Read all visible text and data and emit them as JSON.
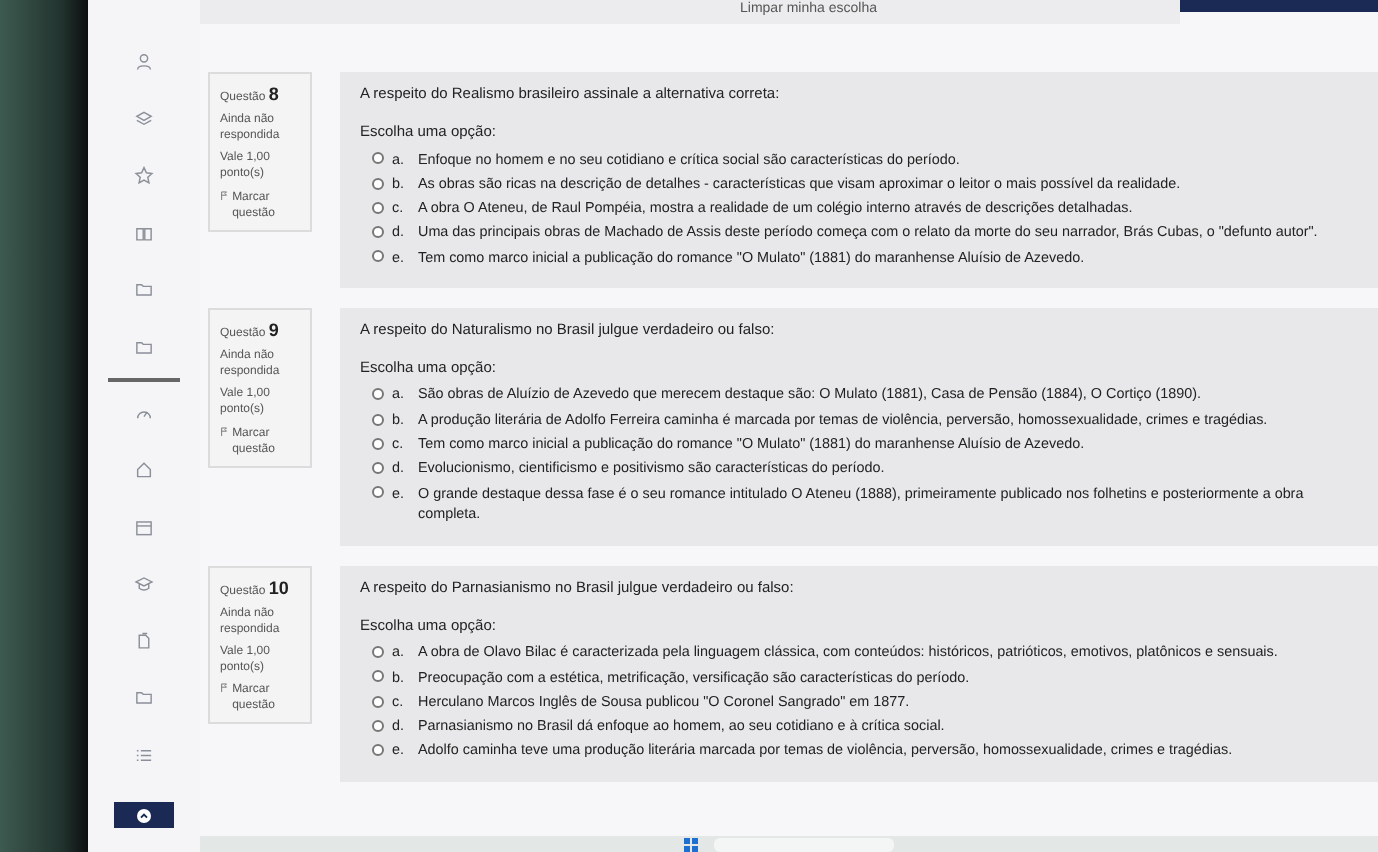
{
  "top_link": "Limpar minha escolha",
  "questions": [
    {
      "label": "Questão",
      "number": "8",
      "status": "Ainda não respondida",
      "points": "Vale 1,00 ponto(s)",
      "flag": "Marcar questão",
      "prompt": "A respeito do Realismo brasileiro assinale a alternativa correta:",
      "instruction": "Escolha uma opção:",
      "options": [
        {
          "letter": "a.",
          "text": "Enfoque no homem e no seu cotidiano e crítica social são características do período.",
          "selected": false
        },
        {
          "letter": "b.",
          "text": "As obras são ricas na descrição de detalhes - características que visam aproximar o leitor o mais possível da realidade.",
          "selected": false
        },
        {
          "letter": "c.",
          "text": "A obra O Ateneu, de Raul Pompéia, mostra a realidade de um colégio interno através de descrições detalhadas.",
          "selected": false
        },
        {
          "letter": "d.",
          "text": "Uma das principais obras de Machado de Assis deste período começa com o relato da morte do seu narrador, Brás Cubas, o \"defunto autor\".",
          "selected": false
        },
        {
          "letter": "e.",
          "text": "Tem como marco inicial a publicação do romance \"O Mulato\" (1881) do maranhense Aluísio de Azevedo.",
          "selected": false
        }
      ]
    },
    {
      "label": "Questão",
      "number": "9",
      "status": "Ainda não respondida",
      "points": "Vale 1,00 ponto(s)",
      "flag": "Marcar questão",
      "prompt": "A respeito do Naturalismo no Brasil julgue verdadeiro ou falso:",
      "instruction": "Escolha uma opção:",
      "options": [
        {
          "letter": "a.",
          "text": "São obras de Aluízio de Azevedo que merecem destaque são: O Mulato (1881), Casa de Pensão (1884), O Cortiço (1890).",
          "selected": false
        },
        {
          "letter": "b.",
          "text": "A produção literária de Adolfo Ferreira caminha é marcada por temas de violência, perversão, homossexualidade, crimes e tragédias.",
          "selected": false
        },
        {
          "letter": "c.",
          "text": "Tem como marco inicial a publicação do romance \"O Mulato\" (1881) do maranhense Aluísio de Azevedo.",
          "selected": false
        },
        {
          "letter": "d.",
          "text": "Evolucionismo, cientificismo e positivismo são características do período.",
          "selected": false
        },
        {
          "letter": "e.",
          "text": "O grande destaque dessa fase é o seu romance intitulado O Ateneu (1888), primeiramente publicado nos folhetins e posteriormente a obra completa.",
          "selected": false
        }
      ]
    },
    {
      "label": "Questão",
      "number": "10",
      "status": "Ainda não respondida",
      "points": "Vale 1,00 ponto(s)",
      "flag": "Marcar questão",
      "prompt": "A respeito do Parnasianismo no Brasil julgue verdadeiro ou falso:",
      "instruction": "Escolha uma opção:",
      "options": [
        {
          "letter": "a.",
          "text": "A obra de Olavo Bilac é caracterizada pela linguagem clássica, com conteúdos: históricos, patrióticos, emotivos, platônicos e sensuais.",
          "selected": false
        },
        {
          "letter": "b.",
          "text": "Preocupação com a estética, metrificação, versificação são características do período.",
          "selected": false
        },
        {
          "letter": "c.",
          "text": "Herculano Marcos Inglês de Sousa  publicou \"O Coronel Sangrado\" em 1877.",
          "selected": false
        },
        {
          "letter": "d.",
          "text": "Parnasianismo no Brasil dá enfoque ao homem, ao seu cotidiano e à crítica social.",
          "selected": false
        },
        {
          "letter": "e.",
          "text": "Adolfo caminha teve uma produção literária marcada por temas de violência, perversão, homossexualidade, crimes e tragédias.",
          "selected": false
        }
      ]
    }
  ]
}
